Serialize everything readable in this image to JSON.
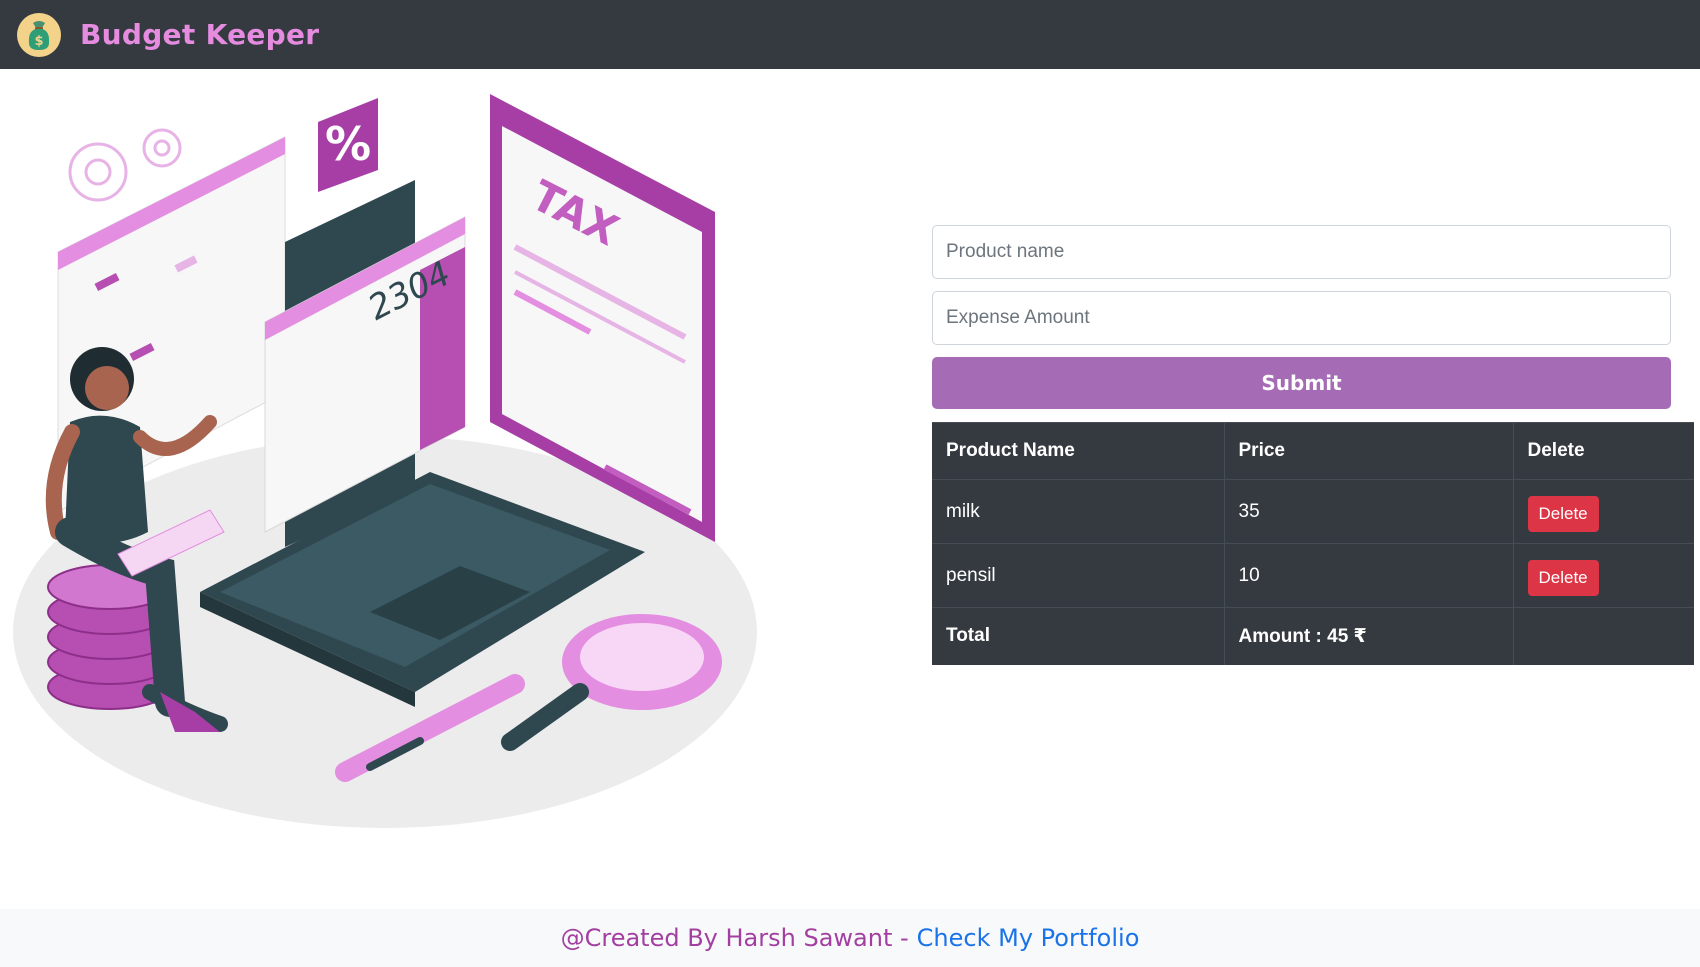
{
  "app": {
    "title": "Budget Keeper",
    "logo_icon": "money-bag-icon"
  },
  "colors": {
    "navbar": "#343a40",
    "brand": "#e58be0",
    "accent": "#a56cb5",
    "danger": "#dc3545",
    "link": "#1a73e8",
    "credit": "#a23fa0"
  },
  "form": {
    "product_placeholder": "Product name",
    "product_value": "",
    "amount_placeholder": "Expense Amount",
    "amount_value": "",
    "submit_label": "Submit"
  },
  "table": {
    "headers": [
      "Product Name",
      "Price",
      "Delete"
    ],
    "rows": [
      {
        "name": "milk",
        "price": "35",
        "action": "Delete"
      },
      {
        "name": "pensil",
        "price": "10",
        "action": "Delete"
      }
    ],
    "total_label": "Total",
    "total_amount": "Amount : 45 ₹"
  },
  "footer": {
    "credit": "@Created By Harsh Sawant -",
    "link_text": "Check My Portfolio"
  },
  "illustration": {
    "calculator_display": "2304",
    "tax_label": "TAX",
    "percent_label": "%"
  }
}
